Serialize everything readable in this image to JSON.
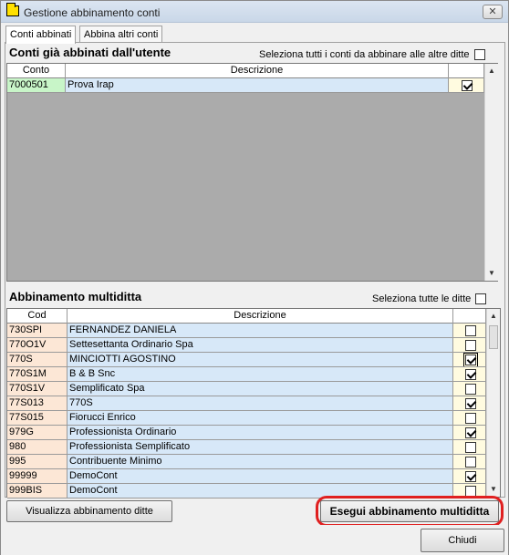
{
  "window": {
    "title": "Gestione abbinamento conti",
    "close_label": "✕"
  },
  "tabs": [
    {
      "label": "Conti abbinati"
    },
    {
      "label": "Abbina altri conti"
    }
  ],
  "top_section": {
    "title": "Conti già abbinati dall'utente",
    "select_all_label": "Seleziona tutti i conti da abbinare alle altre ditte",
    "select_all_checked": false,
    "columns": [
      "Conto",
      "Descrizione",
      ""
    ],
    "rows": [
      {
        "code": "7000501",
        "description": "Prova Irap",
        "checked": true
      }
    ]
  },
  "bottom_section": {
    "title": "Abbinamento multiditta",
    "select_all_label": "Seleziona tutte le ditte",
    "select_all_checked": false,
    "columns": [
      "Cod",
      "Descrizione",
      ""
    ],
    "rows": [
      {
        "code": "730SPI",
        "description": "FERNANDEZ DANIELA",
        "checked": false
      },
      {
        "code": "770O1V",
        "description": "Settesettanta Ordinario Spa",
        "checked": false
      },
      {
        "code": "770S",
        "description": "MINCIOTTI AGOSTINO",
        "checked": true
      },
      {
        "code": "770S1M",
        "description": "B & B Snc",
        "checked": true
      },
      {
        "code": "770S1V",
        "description": "Semplificato Spa",
        "checked": false
      },
      {
        "code": "77S013",
        "description": "770S",
        "checked": true
      },
      {
        "code": "77S015",
        "description": "Fiorucci Enrico",
        "checked": false
      },
      {
        "code": "979G",
        "description": "Professionista Ordinario",
        "checked": true
      },
      {
        "code": "980",
        "description": "Professionista Semplificato",
        "checked": false
      },
      {
        "code": "995",
        "description": "Contribuente Minimo",
        "checked": false
      },
      {
        "code": "99999",
        "description": "DemoCont",
        "checked": true
      },
      {
        "code": "999BIS",
        "description": "DemoCont",
        "checked": false
      }
    ]
  },
  "buttons": {
    "view_label": "Visualizza abbinamento ditte",
    "run_label": "Esegui abbinamento multiditta",
    "close_label": "Chiudi"
  },
  "colors": {
    "highlight_ring": "#e02020",
    "code_cell": "#fce7d6",
    "desc_cell": "#d7e8f8",
    "check_cell": "#fffbe0",
    "selected_code_cell": "#c8f5c8"
  }
}
